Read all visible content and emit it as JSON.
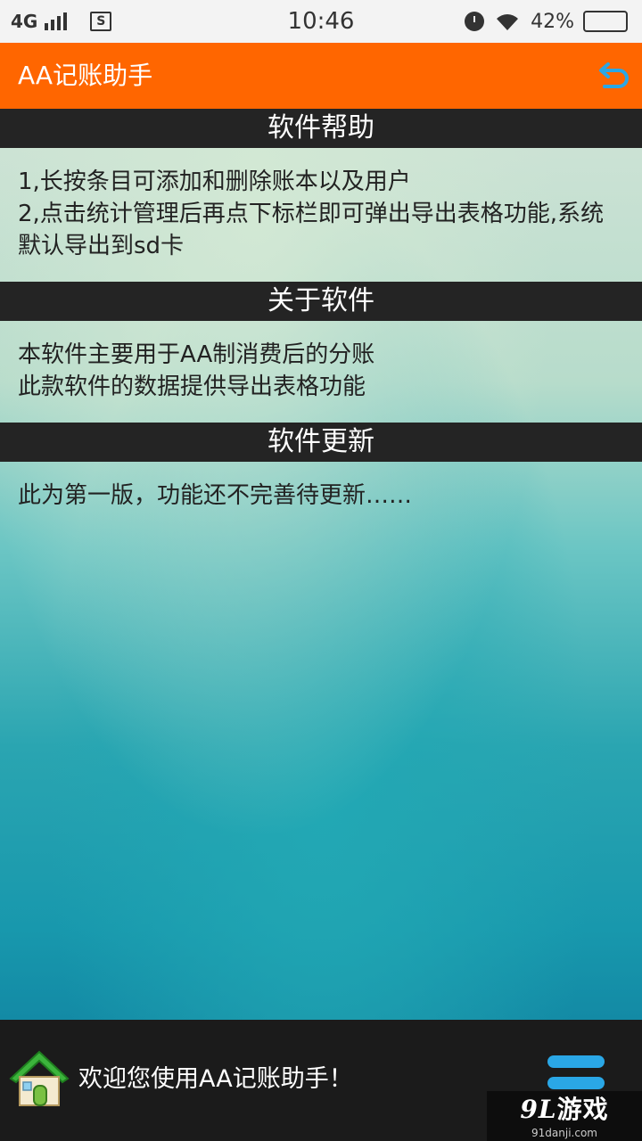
{
  "status_bar": {
    "network": "4G",
    "sim_label": "S",
    "time": "10:46",
    "battery_percent": "42%",
    "battery_level": 0.42,
    "icons": [
      "signal-icon",
      "sim-icon",
      "alarm-icon",
      "wifi-icon",
      "battery-icon"
    ]
  },
  "app_bar": {
    "title": "AA记账助手",
    "back_icon": "undo-arrow-icon",
    "accent_color": "#ff6600",
    "back_icon_color": "#2aa7e6"
  },
  "sections": [
    {
      "header": "软件帮助",
      "lines": [
        "1,长按条目可添加和删除账本以及用户",
        "2,点击统计管理后再点下标栏即可弹出导出表格功能,系统",
        "默认导出到sd卡"
      ]
    },
    {
      "header": "关于软件",
      "lines": [
        "本软件主要用于AA制消费后的分账",
        "此款软件的数据提供导出表格功能"
      ]
    },
    {
      "header": "软件更新",
      "lines": [
        "此为第一版，功能还不完善待更新……"
      ]
    }
  ],
  "bottom_bar": {
    "home_icon": "house-icon",
    "welcome_text": "欢迎您使用AA记账助手！",
    "menu_icon": "menu-icon"
  },
  "watermark": {
    "logo_text": "游戏",
    "logo_number": "9L",
    "url": "91danji.com"
  }
}
